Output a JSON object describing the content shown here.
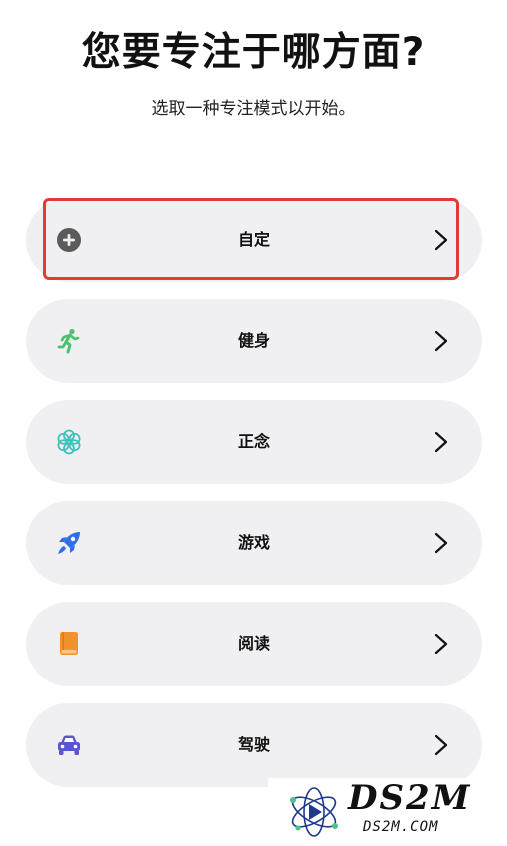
{
  "header": {
    "title": "您要专注于哪方面?",
    "subtitle": "选取一种专注模式以开始。"
  },
  "modes": [
    {
      "label": "自定",
      "icon": "plus-circle-icon",
      "color": "#5b5b5b",
      "highlighted": true
    },
    {
      "label": "健身",
      "icon": "running-person-icon",
      "color": "#49c36b"
    },
    {
      "label": "正念",
      "icon": "flower-icon",
      "color": "#3fc2bb"
    },
    {
      "label": "游戏",
      "icon": "rocket-icon",
      "color": "#2e6fe8"
    },
    {
      "label": "阅读",
      "icon": "book-icon",
      "color": "#f0932b"
    },
    {
      "label": "驾驶",
      "icon": "car-icon",
      "color": "#5a55d6"
    }
  ],
  "colors": {
    "item_background": "#f0eff2",
    "highlight_border": "#e23b35"
  },
  "watermark": {
    "brand": "DS2M",
    "domain": "DS2M.COM"
  }
}
